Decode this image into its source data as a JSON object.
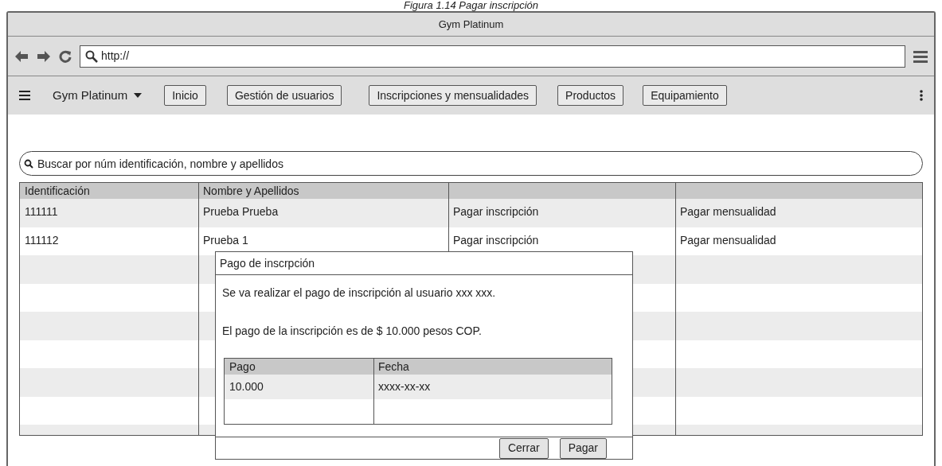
{
  "caption": "Figura 1.14 Pagar inscripción",
  "window": {
    "title": "Gym Platinum"
  },
  "address_bar": {
    "value": "http://"
  },
  "navbar": {
    "brand": "Gym Platinum",
    "items": [
      {
        "label": "Inicio"
      },
      {
        "label": "Gestión de usuarios"
      },
      {
        "label": "Inscripciones y mensualidades"
      },
      {
        "label": "Productos"
      },
      {
        "label": "Equipamiento"
      }
    ]
  },
  "search": {
    "placeholder": "Buscar por núm identificación, nombre y apellidos"
  },
  "table": {
    "columns": [
      "Identificación",
      "Nombre y Apellidos",
      "",
      ""
    ],
    "rows": [
      [
        "111111",
        "Prueba Prueba",
        "Pagar inscripción",
        "Pagar mensualidad"
      ],
      [
        "111112",
        "Prueba 1",
        "Pagar inscripción",
        "Pagar mensualidad"
      ]
    ]
  },
  "dialog": {
    "title": "Pago de inscrpción",
    "messages": [
      "Se va realizar el pago de inscripción al usuario xxx xxx.",
      "El pago de la inscripción es de $ 10.000 pesos COP."
    ],
    "table": {
      "columns": [
        "Pago",
        "Fecha"
      ],
      "rows": [
        [
          "10.000",
          "xxxx-xx-xx"
        ]
      ]
    },
    "buttons": [
      "Cerrar",
      "Pagar"
    ]
  }
}
